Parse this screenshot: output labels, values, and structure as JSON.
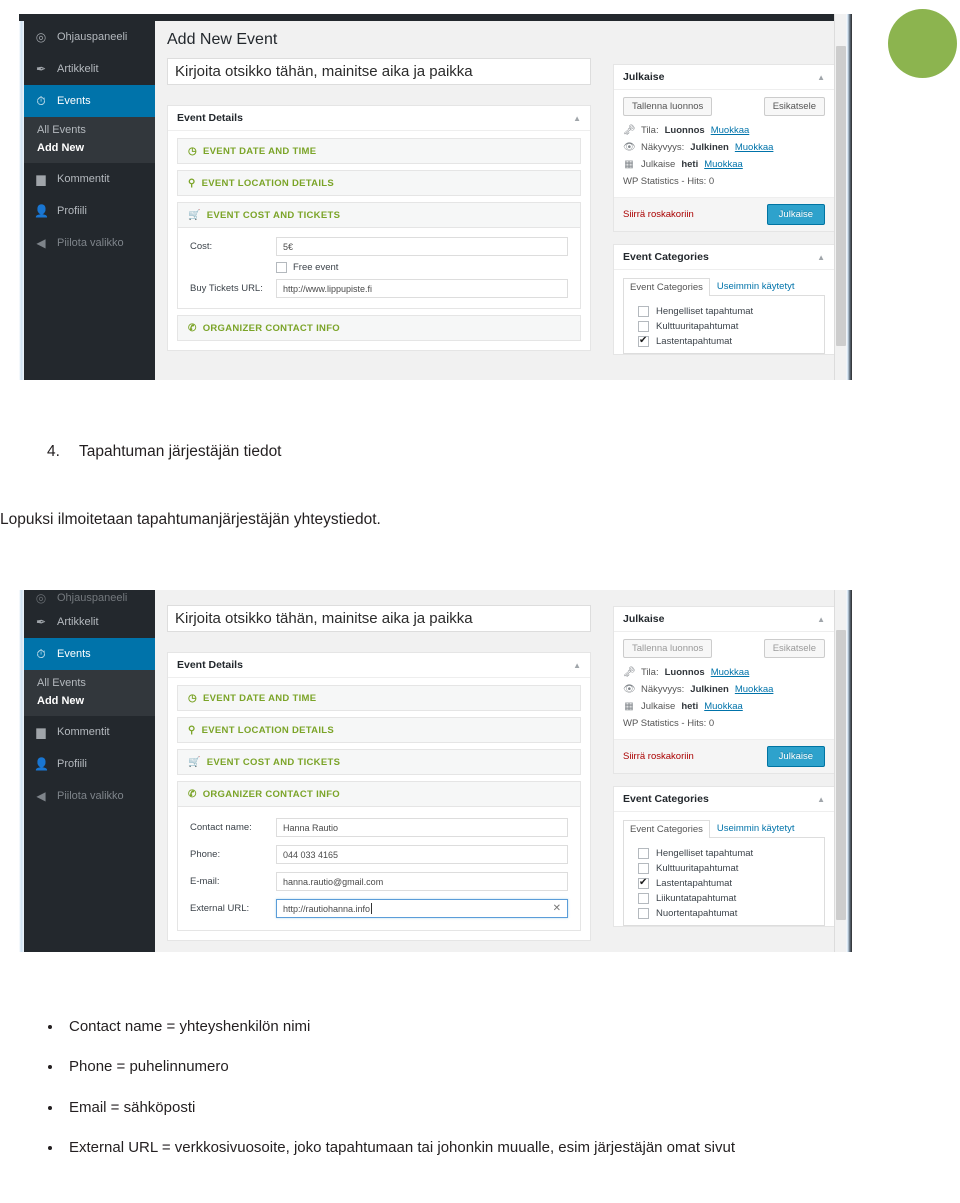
{
  "document": {
    "heading_number": "4.",
    "heading_text": "Tapahtuman järjestäjän tiedot",
    "paragraph": "Lopuksi ilmoitetaan tapahtumanjärjestäjän yhteystiedot.",
    "bullets": [
      "Contact name = yhteyshenkilön nimi",
      "Phone = puhelinnumero",
      "Email = sähköposti",
      "External URL = verkkosivuosoite, joko tapahtumaan tai johonkin muualle, esim järjestäjän omat sivut"
    ]
  },
  "colors": {
    "accent_green": "#8cb44f",
    "wp_blue": "#0073aa",
    "wp_sidebar": "#23282d",
    "section_green": "#7ba428",
    "publish_button": "#2ea2cc",
    "trash_red": "#a00000"
  },
  "screenshot1": {
    "page_title": "Add New Event",
    "sidebar": {
      "items": [
        {
          "label": "Ohjauspaneeli",
          "icon": "dashboard-icon",
          "state": "normal"
        },
        {
          "label": "Artikkelit",
          "icon": "pin-icon",
          "state": "normal"
        },
        {
          "label": "Events",
          "icon": "stopwatch-icon",
          "state": "active"
        },
        {
          "label": "Kommentit",
          "icon": "comment-icon",
          "state": "normal"
        },
        {
          "label": "Profiili",
          "icon": "user-icon",
          "state": "normal"
        },
        {
          "label": "Piilota valikko",
          "icon": "collapse-arrow-icon",
          "state": "faded"
        }
      ],
      "submenu": [
        {
          "label": "All Events",
          "current": false
        },
        {
          "label": "Add New",
          "current": true
        }
      ]
    },
    "title_field": {
      "value": "Kirjoita otsikko tähän, mainitse aika ja paikka"
    },
    "event_details": {
      "box_title": "Event Details",
      "toggle_icon": "chevron-up-icon",
      "sections": [
        {
          "label": "EVENT DATE AND TIME",
          "icon": "clock-icon",
          "open": false
        },
        {
          "label": "EVENT LOCATION DETAILS",
          "icon": "map-pin-icon",
          "open": false
        },
        {
          "label": "EVENT COST AND TICKETS",
          "icon": "cart-icon",
          "open": true
        },
        {
          "label": "ORGANIZER CONTACT INFO",
          "icon": "phone-icon",
          "open": false
        }
      ],
      "cost_panel": {
        "cost_label": "Cost:",
        "cost_value": "5€",
        "free_event_label": "Free event",
        "free_event_checked": false,
        "tickets_label": "Buy Tickets URL:",
        "tickets_value": "http://www.lippupiste.fi"
      }
    },
    "publish_box": {
      "title": "Julkaise",
      "toggle_icon": "chevron-up-icon",
      "save_draft": "Tallenna luonnos",
      "preview": "Esikatsele",
      "rows": [
        {
          "icon": "key-icon",
          "prefix": "Tila:",
          "value": "Luonnos",
          "link": "Muokkaa"
        },
        {
          "icon": "eye-icon",
          "prefix": "Näkyvyys:",
          "value": "Julkinen",
          "link": "Muokkaa"
        },
        {
          "icon": "calendar-icon",
          "prefix": "Julkaise",
          "value": "heti",
          "link": "Muokkaa"
        }
      ],
      "stats": "WP Statistics - Hits: 0",
      "trash": "Siirrä roskakoriin",
      "publish": "Julkaise"
    },
    "categories_box": {
      "title": "Event Categories",
      "toggle_icon": "chevron-up-icon",
      "tab_all": "Event Categories",
      "tab_used": "Useimmin käytetyt",
      "items": [
        {
          "label": "Hengelliset tapahtumat",
          "checked": false
        },
        {
          "label": "Kulttuuritapahtumat",
          "checked": false
        },
        {
          "label": "Lastentapahtumat",
          "checked": true
        }
      ]
    }
  },
  "screenshot2": {
    "sidebar": {
      "items": [
        {
          "label": "Ohjauspaneeli",
          "icon": "dashboard-icon",
          "state": "clipped"
        },
        {
          "label": "Artikkelit",
          "icon": "pin-icon",
          "state": "normal"
        },
        {
          "label": "Events",
          "icon": "stopwatch-icon",
          "state": "active"
        },
        {
          "label": "Kommentit",
          "icon": "comment-icon",
          "state": "normal"
        },
        {
          "label": "Profiili",
          "icon": "user-icon",
          "state": "normal"
        },
        {
          "label": "Piilota valikko",
          "icon": "collapse-arrow-icon",
          "state": "faded"
        }
      ],
      "submenu": [
        {
          "label": "All Events",
          "current": false
        },
        {
          "label": "Add New",
          "current": true
        }
      ]
    },
    "title_field": {
      "value": "Kirjoita otsikko tähän, mainitse aika ja paikka"
    },
    "event_details": {
      "box_title": "Event Details",
      "toggle_icon": "chevron-up-icon",
      "sections": [
        {
          "label": "EVENT DATE AND TIME",
          "icon": "clock-icon",
          "open": false
        },
        {
          "label": "EVENT LOCATION DETAILS",
          "icon": "map-pin-icon",
          "open": false
        },
        {
          "label": "EVENT COST AND TICKETS",
          "icon": "cart-icon",
          "open": false
        },
        {
          "label": "ORGANIZER CONTACT INFO",
          "icon": "phone-icon",
          "open": true
        }
      ],
      "organizer_panel": {
        "fields": [
          {
            "label": "Contact name:",
            "value": "Hanna Rautio",
            "focused": false,
            "clearable": false
          },
          {
            "label": "Phone:",
            "value": "044 033 4165",
            "focused": false,
            "clearable": false
          },
          {
            "label": "E-mail:",
            "value": "hanna.rautio@gmail.com",
            "focused": false,
            "clearable": false
          },
          {
            "label": "External URL:",
            "value": "http://rautiohanna.info",
            "focused": true,
            "clearable": true
          }
        ],
        "clear_icon": "close-x-icon"
      }
    },
    "publish_box": {
      "title": "Julkaise",
      "toggle_icon": "chevron-up-icon",
      "save_draft": "Tallenna luonnos",
      "preview": "Esikatsele",
      "rows": [
        {
          "icon": "key-icon",
          "prefix": "Tila:",
          "value": "Luonnos",
          "link": "Muokkaa"
        },
        {
          "icon": "eye-icon",
          "prefix": "Näkyvyys:",
          "value": "Julkinen",
          "link": "Muokkaa"
        },
        {
          "icon": "calendar-icon",
          "prefix": "Julkaise",
          "value": "heti",
          "link": "Muokkaa"
        }
      ],
      "stats": "WP Statistics - Hits: 0",
      "trash": "Siirrä roskakoriin",
      "publish": "Julkaise"
    },
    "categories_box": {
      "title": "Event Categories",
      "toggle_icon": "chevron-up-icon",
      "tab_all": "Event Categories",
      "tab_used": "Useimmin käytetyt",
      "items": [
        {
          "label": "Hengelliset tapahtumat",
          "checked": false
        },
        {
          "label": "Kulttuuritapahtumat",
          "checked": false
        },
        {
          "label": "Lastentapahtumat",
          "checked": true
        },
        {
          "label": "Liikuntatapahtumat",
          "checked": false
        },
        {
          "label": "Nuortentapahtumat",
          "checked": false
        }
      ]
    }
  }
}
